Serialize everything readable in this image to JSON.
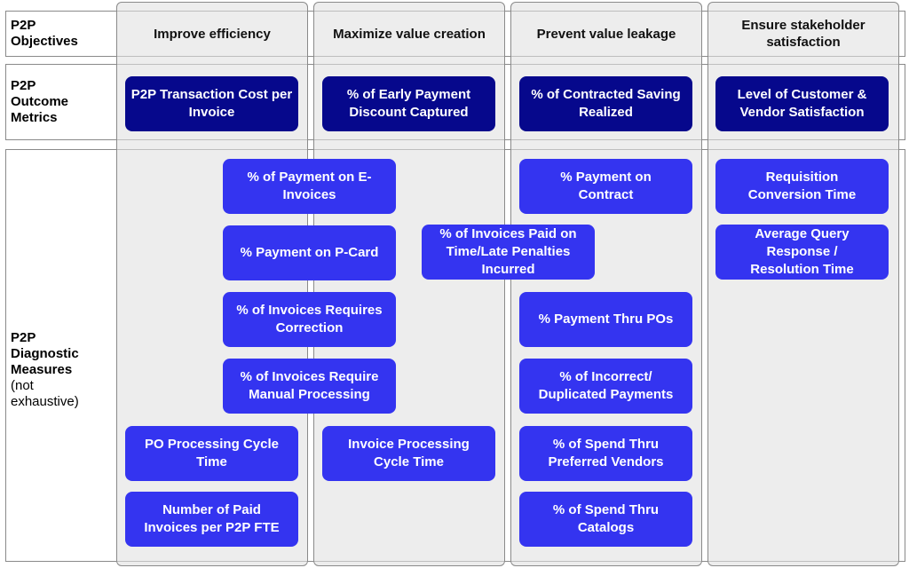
{
  "colors": {
    "outcome_box": "#06088c",
    "diagnostic_box": "#3434f0",
    "column_bg": "#ececec"
  },
  "rows": {
    "objectives": "P2P Objectives",
    "outcome": "P2P Outcome Metrics",
    "diagnostic": "P2P Diagnostic Measures",
    "diagnostic_note": "(not exhaustive)"
  },
  "objectives": [
    "Improve efficiency",
    "Maximize value creation",
    "Prevent value leakage",
    "Ensure stakeholder satisfaction"
  ],
  "outcome_metrics": [
    "P2P Transaction Cost per Invoice",
    "% of Early Payment Discount Captured",
    "% of Contracted Saving Realized",
    "Level of Customer & Vendor Satisfaction"
  ],
  "diagnostic_measures": [
    "% of Payment on E-Invoices",
    "% Payment on P-Card",
    "% of Invoices Requires Correction",
    "% of Invoices Require Manual Processing",
    "PO Processing Cycle Time",
    "Number of Paid Invoices per P2P FTE",
    "Invoice Processing Cycle Time",
    "% of Invoices Paid on Time/Late Penalties Incurred",
    "% Payment on Contract",
    "% Payment Thru POs",
    "% of Incorrect/ Duplicated Payments",
    "% of Spend Thru Preferred Vendors",
    "% of Spend Thru Catalogs",
    "Requisition Conversion Time",
    "Average Query Response / Resolution Time"
  ]
}
